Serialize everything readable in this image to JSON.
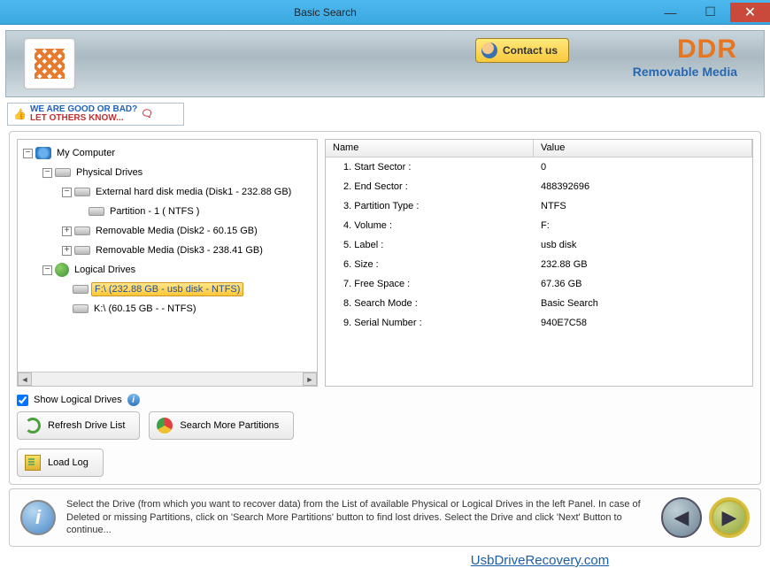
{
  "window": {
    "title": "Basic Search"
  },
  "banner": {
    "contact_label": "Contact us",
    "brand": "DDR",
    "subbrand": "Removable Media"
  },
  "feedback": {
    "line1": "WE ARE GOOD OR BAD?",
    "line2": "LET OTHERS KNOW..."
  },
  "tree": {
    "root": "My Computer",
    "physical": {
      "label": "Physical Drives",
      "items": [
        {
          "label": "External hard disk media (Disk1 - 232.88 GB)",
          "toggle": "−",
          "children": [
            {
              "label": "Partition - 1 ( NTFS )"
            }
          ]
        },
        {
          "label": "Removable Media (Disk2 - 60.15 GB)",
          "toggle": "+"
        },
        {
          "label": "Removable Media (Disk3 - 238.41 GB)",
          "toggle": "+"
        }
      ]
    },
    "logical": {
      "label": "Logical Drives",
      "items": [
        {
          "label": "F:\\ (232.88 GB - usb disk - NTFS)",
          "selected": true
        },
        {
          "label": "K:\\ (60.15 GB -  - NTFS)"
        }
      ]
    }
  },
  "props": {
    "header_name": "Name",
    "header_value": "Value",
    "rows": [
      {
        "name": "1. Start Sector :",
        "value": "0"
      },
      {
        "name": "2. End Sector :",
        "value": "488392696"
      },
      {
        "name": "3. Partition Type :",
        "value": "NTFS"
      },
      {
        "name": "4. Volume :",
        "value": "F:"
      },
      {
        "name": "5. Label :",
        "value": "usb disk"
      },
      {
        "name": "6. Size :",
        "value": "232.88 GB"
      },
      {
        "name": "7. Free Space :",
        "value": "67.36 GB"
      },
      {
        "name": "8. Search Mode :",
        "value": "Basic Search"
      },
      {
        "name": "9. Serial Number :",
        "value": "940E7C58"
      }
    ]
  },
  "controls": {
    "show_logical": "Show Logical Drives",
    "refresh": "Refresh Drive List",
    "search_more": "Search More Partitions",
    "load_log": "Load Log"
  },
  "hint": "Select the Drive (from which you want to recover data) from the List of available Physical or Logical Drives in the left Panel. In case of Deleted or missing Partitions, click on 'Search More Partitions' button to find lost drives. Select the Drive and click 'Next' Button to continue...",
  "footer": {
    "url": "UsbDriveRecovery.com"
  }
}
